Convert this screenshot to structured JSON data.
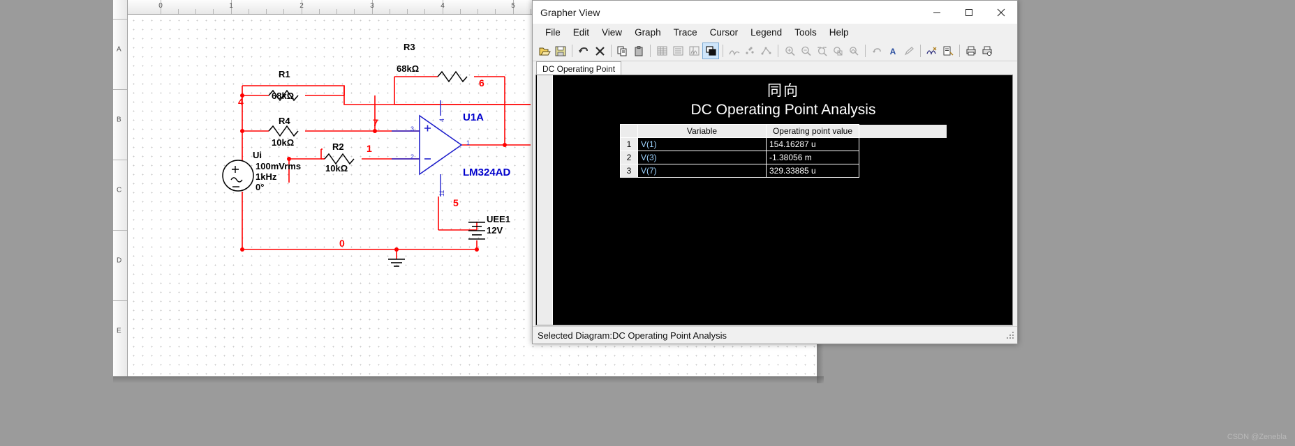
{
  "workspace": {
    "ruler_top_labels": [
      "0",
      "1",
      "2",
      "3",
      "4",
      "5"
    ],
    "ruler_left_labels": [
      "A",
      "B",
      "C",
      "D",
      "E"
    ],
    "circuit": {
      "components": [
        {
          "ref": "R3",
          "value": "68kΩ"
        },
        {
          "ref": "R1",
          "value": "68kΩ"
        },
        {
          "ref": "R4",
          "value": "10kΩ"
        },
        {
          "ref": "R2",
          "value": "10kΩ"
        }
      ],
      "source": {
        "ref": "Ui",
        "amplitude": "100mVrms",
        "frequency": "1kHz",
        "phase": "0°"
      },
      "battery": {
        "ref": "UEE1",
        "value": "12V"
      },
      "opamp": {
        "ref": "U1A",
        "part": "LM324AD",
        "pins": [
          "4",
          "3",
          "2",
          "1",
          "11"
        ]
      },
      "net_labels": [
        "4",
        "6",
        "7",
        "1",
        "5",
        "0"
      ]
    }
  },
  "grapher": {
    "title": "Grapher View",
    "window_buttons": {
      "minimize": "—",
      "maximize": "□",
      "close": "✕"
    },
    "menu": [
      "File",
      "Edit",
      "View",
      "Graph",
      "Trace",
      "Cursor",
      "Legend",
      "Tools",
      "Help"
    ],
    "toolbar_icons": [
      "open-folder-icon",
      "save-icon",
      "undo-icon",
      "delete-x-icon",
      "copy-icon",
      "paste-icon",
      "grid-icon",
      "legend-icon",
      "cursors-icon",
      "select-layer-icon",
      "trace-curve-icon",
      "trace-points-icon",
      "trace-points-line-icon",
      "zoom-in-icon",
      "zoom-out-icon",
      "zoom-region-icon",
      "zoom-restore-icon",
      "zoom-fit-icon",
      "undo-zoom-icon",
      "text-icon",
      "pencil-icon",
      "properties-icon",
      "page-properties-icon",
      "print-icon",
      "print-preview-icon"
    ],
    "tab": "DC Operating Point",
    "chart_title_cn": "同向",
    "chart_title": "DC Operating Point Analysis",
    "table": {
      "headers": [
        "",
        "Variable",
        "Operating point value"
      ],
      "rows": [
        {
          "index": "1",
          "variable": "V(1)",
          "value": "154.16287 u"
        },
        {
          "index": "2",
          "variable": "V(3)",
          "value": "-1.38056 m"
        },
        {
          "index": "3",
          "variable": "V(7)",
          "value": "329.33885 u"
        }
      ]
    },
    "status": "Selected Diagram:DC Operating Point Analysis"
  },
  "watermark": "CSDN @Zenebla",
  "chart_data": {
    "type": "table",
    "title": "DC Operating Point Analysis",
    "subtitle": "同向",
    "columns": [
      "Variable",
      "Operating point value"
    ],
    "rows": [
      [
        "V(1)",
        "154.16287 u"
      ],
      [
        "V(3)",
        "-1.38056 m"
      ],
      [
        "V(7)",
        "329.33885 u"
      ]
    ]
  }
}
